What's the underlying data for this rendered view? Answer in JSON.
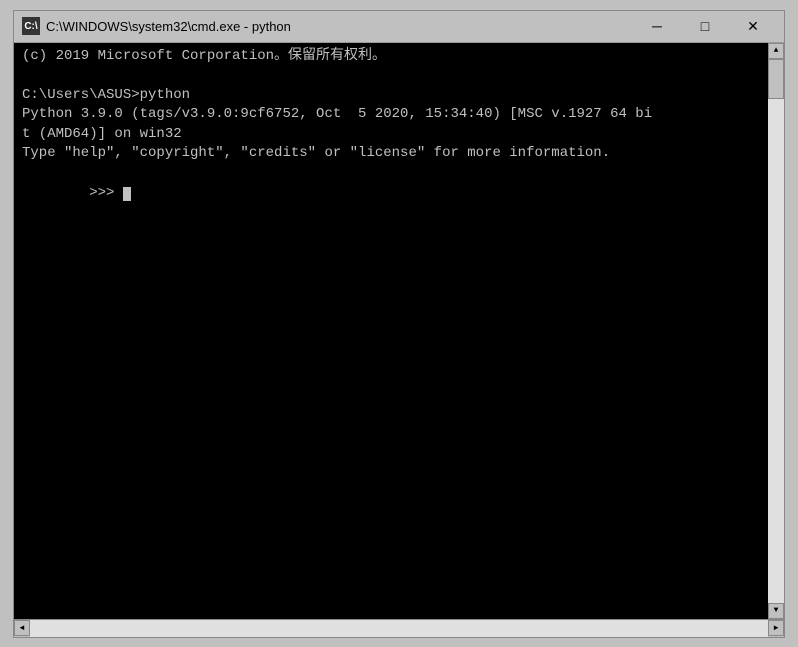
{
  "titleBar": {
    "iconLabel": "C:\\",
    "title": "C:\\WINDOWS\\system32\\cmd.exe - python",
    "minimizeLabel": "─",
    "maximizeLabel": "□",
    "closeLabel": "✕"
  },
  "terminal": {
    "line1": "(c) 2019 Microsoft Corporation。保留所有权利。",
    "line2": "",
    "line3": "C:\\Users\\ASUS>python",
    "line4": "Python 3.9.0 (tags/v3.9.0:9cf6752, Oct  5 2020, 15:34:40) [MSC v.1927 64 bi",
    "line5": "t (AMD64)] on win32",
    "line6": "Type \"help\", \"copyright\", \"credits\" or \"license\" for more information.",
    "line7": ">>> "
  }
}
